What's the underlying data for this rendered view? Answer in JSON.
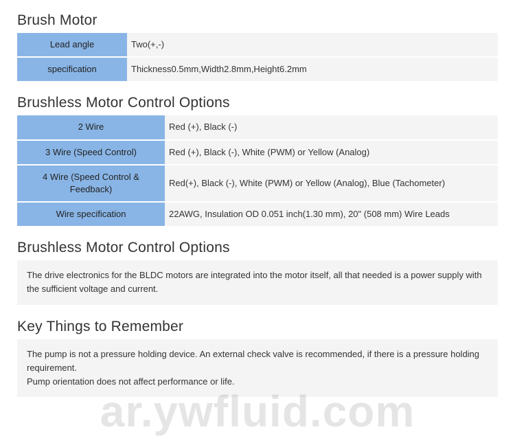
{
  "brush_motor": {
    "title": "Brush Motor",
    "rows": [
      {
        "label": "Lead angle",
        "value": "Two(+,-)"
      },
      {
        "label": "specification",
        "value": "Thickness0.5mm,Width2.8mm,Height6.2mm"
      }
    ]
  },
  "brushless_options_table": {
    "title": "Brushless Motor Control Options",
    "rows": [
      {
        "label": "2 Wire",
        "value": "Red (+), Black (-)"
      },
      {
        "label": "3 Wire (Speed Control)",
        "value": "Red (+), Black (-), White (PWM) or Yellow (Analog)"
      },
      {
        "label": "4 Wire (Speed Control & Feedback)",
        "value": "Red(+), Black (-), White (PWM) or Yellow (Analog), Blue (Tachometer)"
      },
      {
        "label": "Wire specification",
        "value": "22AWG, Insulation OD 0.051 inch(1.30 mm), 20\" (508 mm) Wire Leads"
      }
    ]
  },
  "brushless_options_text": {
    "title": "Brushless Motor Control Options",
    "body": "The drive electronics for the BLDC motors are integrated into the motor itself, all that needed is a power supply with the sufficient voltage and current."
  },
  "key_things": {
    "title": "Key Things to Remember",
    "line1": "The pump is not a pressure holding device. An external check valve is recommended, if there is a pressure holding requirement.",
    "line2": "Pump orientation does not affect performance or life."
  },
  "watermark": "ar.ywfluid.com"
}
